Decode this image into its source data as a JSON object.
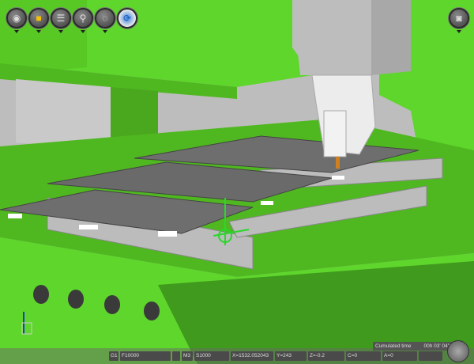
{
  "toolbar": {
    "buttons": [
      {
        "name": "view-settings-button",
        "icon": "view-icon",
        "has_menu": true
      },
      {
        "name": "solid-display-button",
        "icon": "cube-icon",
        "has_menu": true
      },
      {
        "name": "stock-button",
        "icon": "cylinder-icon",
        "has_menu": true
      },
      {
        "name": "zoom-button",
        "icon": "magnifier-icon",
        "has_menu": true
      },
      {
        "name": "rotate-point-button",
        "icon": "dotted-circle-icon",
        "has_menu": true
      },
      {
        "name": "orbit-button",
        "icon": "rotate-icon",
        "has_menu": false
      }
    ],
    "camera_button": {
      "icon": "camera-icon",
      "has_menu": true
    }
  },
  "status": {
    "g_code": "G1",
    "feed": "F10000",
    "blank1": "",
    "m_code": "M3",
    "spindle": "S1000",
    "x": "X=1532.052043",
    "y": "Y=243",
    "z": "Z=-0.2",
    "c": "C=0",
    "a": "A=0",
    "blank2": ""
  },
  "cumulated": {
    "label": "Cumulated time",
    "value": "00h 03' 04\""
  },
  "colors": {
    "machine": "#5ed62b",
    "machine_dark": "#3f9a1d",
    "plates": "#6e6e6e",
    "background": "#b9b9b9"
  }
}
